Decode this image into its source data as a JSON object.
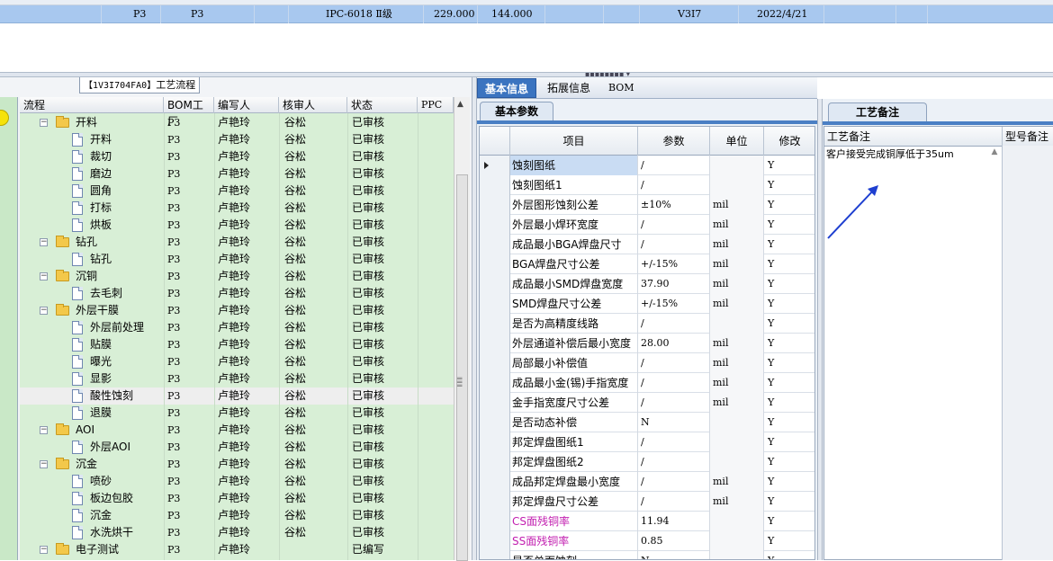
{
  "top_row": {
    "cells": [
      "P3",
      "P3",
      "IPC-6018 Ⅱ级",
      "229.000",
      "144.000",
      "V3I7",
      "2022/4/21"
    ]
  },
  "left_panel": {
    "title_code": "【1V3I704FA0】",
    "title_text": "工艺流程",
    "columns": [
      "流程",
      "BOM工厂",
      "编写人",
      "核审人",
      "状态",
      "PPC"
    ],
    "rows": [
      {
        "level": 0,
        "name": "开料",
        "bom": "P3",
        "writer": "卢艳玲",
        "reviewer": "谷松",
        "status": "已审核"
      },
      {
        "level": 1,
        "name": "开料",
        "bom": "P3",
        "writer": "卢艳玲",
        "reviewer": "谷松",
        "status": "已审核"
      },
      {
        "level": 1,
        "name": "裁切",
        "bom": "P3",
        "writer": "卢艳玲",
        "reviewer": "谷松",
        "status": "已审核"
      },
      {
        "level": 1,
        "name": "磨边",
        "bom": "P3",
        "writer": "卢艳玲",
        "reviewer": "谷松",
        "status": "已审核"
      },
      {
        "level": 1,
        "name": "圆角",
        "bom": "P3",
        "writer": "卢艳玲",
        "reviewer": "谷松",
        "status": "已审核"
      },
      {
        "level": 1,
        "name": "打标",
        "bom": "P3",
        "writer": "卢艳玲",
        "reviewer": "谷松",
        "status": "已审核"
      },
      {
        "level": 1,
        "name": "烘板",
        "bom": "P3",
        "writer": "卢艳玲",
        "reviewer": "谷松",
        "status": "已审核"
      },
      {
        "level": 0,
        "name": "钻孔",
        "bom": "P3",
        "writer": "卢艳玲",
        "reviewer": "谷松",
        "status": "已审核"
      },
      {
        "level": 1,
        "name": "钻孔",
        "bom": "P3",
        "writer": "卢艳玲",
        "reviewer": "谷松",
        "status": "已审核"
      },
      {
        "level": 0,
        "name": "沉铜",
        "bom": "P3",
        "writer": "卢艳玲",
        "reviewer": "谷松",
        "status": "已审核"
      },
      {
        "level": 1,
        "name": "去毛刺",
        "bom": "P3",
        "writer": "卢艳玲",
        "reviewer": "谷松",
        "status": "已审核"
      },
      {
        "level": 0,
        "name": "外层干膜",
        "bom": "P3",
        "writer": "卢艳玲",
        "reviewer": "谷松",
        "status": "已审核"
      },
      {
        "level": 1,
        "name": "外层前处理",
        "bom": "P3",
        "writer": "卢艳玲",
        "reviewer": "谷松",
        "status": "已审核"
      },
      {
        "level": 1,
        "name": "贴膜",
        "bom": "P3",
        "writer": "卢艳玲",
        "reviewer": "谷松",
        "status": "已审核"
      },
      {
        "level": 1,
        "name": "曝光",
        "bom": "P3",
        "writer": "卢艳玲",
        "reviewer": "谷松",
        "status": "已审核"
      },
      {
        "level": 1,
        "name": "显影",
        "bom": "P3",
        "writer": "卢艳玲",
        "reviewer": "谷松",
        "status": "已审核"
      },
      {
        "level": 1,
        "name": "酸性蚀刻",
        "bom": "P3",
        "writer": "卢艳玲",
        "reviewer": "谷松",
        "status": "已审核",
        "selected": true
      },
      {
        "level": 1,
        "name": "退膜",
        "bom": "P3",
        "writer": "卢艳玲",
        "reviewer": "谷松",
        "status": "已审核"
      },
      {
        "level": 0,
        "name": "AOI",
        "bom": "P3",
        "writer": "卢艳玲",
        "reviewer": "谷松",
        "status": "已审核"
      },
      {
        "level": 1,
        "name": "外层AOI",
        "bom": "P3",
        "writer": "卢艳玲",
        "reviewer": "谷松",
        "status": "已审核"
      },
      {
        "level": 0,
        "name": "沉金",
        "bom": "P3",
        "writer": "卢艳玲",
        "reviewer": "谷松",
        "status": "已审核"
      },
      {
        "level": 1,
        "name": "喷砂",
        "bom": "P3",
        "writer": "卢艳玲",
        "reviewer": "谷松",
        "status": "已审核"
      },
      {
        "level": 1,
        "name": "板边包胶",
        "bom": "P3",
        "writer": "卢艳玲",
        "reviewer": "谷松",
        "status": "已审核"
      },
      {
        "level": 1,
        "name": "沉金",
        "bom": "P3",
        "writer": "卢艳玲",
        "reviewer": "谷松",
        "status": "已审核"
      },
      {
        "level": 1,
        "name": "水洗烘干",
        "bom": "P3",
        "writer": "卢艳玲",
        "reviewer": "谷松",
        "status": "已审核"
      },
      {
        "level": 0,
        "name": "电子测试",
        "bom": "P3",
        "writer": "卢艳玲",
        "reviewer": "",
        "status": "已编写"
      }
    ]
  },
  "middle_panel": {
    "tabs": [
      "基本信息",
      "拓展信息",
      "BOM"
    ],
    "subtab": "基本参数",
    "columns": [
      "项目",
      "参数",
      "单位",
      "修改"
    ],
    "rows": [
      {
        "name": "蚀刻图纸",
        "value": "/",
        "unit": "",
        "mod": "Y"
      },
      {
        "name": "蚀刻图纸1",
        "value": "/",
        "unit": "",
        "mod": "Y"
      },
      {
        "name": "外层图形蚀刻公差",
        "value": "±10%",
        "unit": "mil",
        "mod": "Y"
      },
      {
        "name": "外层最小焊环宽度",
        "value": "/",
        "unit": "mil",
        "mod": "Y"
      },
      {
        "name": "成品最小BGA焊盘尺寸",
        "value": "/",
        "unit": "mil",
        "mod": "Y"
      },
      {
        "name": "BGA焊盘尺寸公差",
        "value": "+/-15%",
        "unit": "mil",
        "mod": "Y"
      },
      {
        "name": "成品最小SMD焊盘宽度",
        "value": "37.90",
        "unit": "mil",
        "mod": "Y"
      },
      {
        "name": "SMD焊盘尺寸公差",
        "value": "+/-15%",
        "unit": "mil",
        "mod": "Y"
      },
      {
        "name": "是否为高精度线路",
        "value": "/",
        "unit": "",
        "mod": "Y"
      },
      {
        "name": "外层通道补偿后最小宽度",
        "value": "28.00",
        "unit": "mil",
        "mod": "Y"
      },
      {
        "name": "局部最小补偿值",
        "value": "/",
        "unit": "mil",
        "mod": "Y"
      },
      {
        "name": "成品最小金(锡)手指宽度",
        "value": "/",
        "unit": "mil",
        "mod": "Y"
      },
      {
        "name": "金手指宽度尺寸公差",
        "value": "/",
        "unit": "mil",
        "mod": "Y"
      },
      {
        "name": "是否动态补偿",
        "value": "N",
        "unit": "",
        "mod": "Y"
      },
      {
        "name": "邦定焊盘图纸1",
        "value": "/",
        "unit": "",
        "mod": "Y"
      },
      {
        "name": "邦定焊盘图纸2",
        "value": "/",
        "unit": "",
        "mod": "Y"
      },
      {
        "name": "成品邦定焊盘最小宽度",
        "value": "/",
        "unit": "mil",
        "mod": "Y"
      },
      {
        "name": "邦定焊盘尺寸公差",
        "value": "/",
        "unit": "mil",
        "mod": "Y"
      },
      {
        "name": "CS面残铜率",
        "value": "11.94",
        "unit": "",
        "mod": "Y",
        "purple": true
      },
      {
        "name": "SS面残铜率",
        "value": "0.85",
        "unit": "",
        "mod": "Y",
        "purple": true
      },
      {
        "name": "是否单面蚀刻",
        "value": "N",
        "unit": "",
        "mod": "Y"
      }
    ]
  },
  "right_panel": {
    "tab": "工艺备注",
    "columns": [
      "工艺备注",
      "型号备注"
    ],
    "remark": "客户接受完成铜厚低于35um"
  }
}
